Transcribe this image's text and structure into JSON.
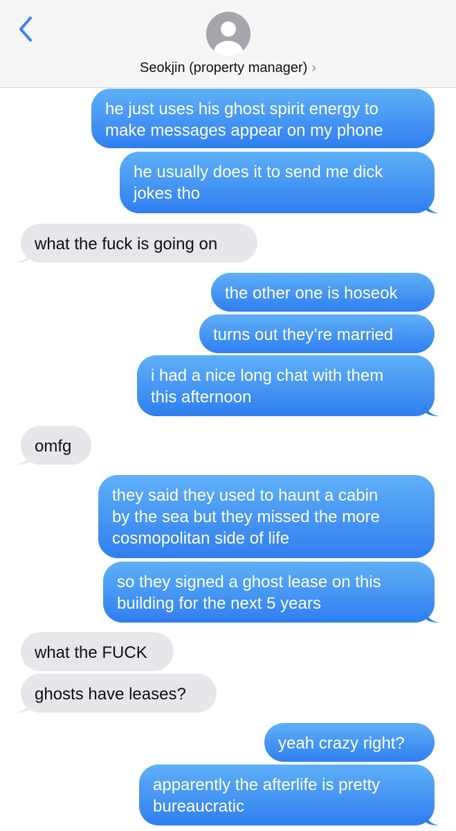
{
  "header": {
    "contact_name": "Seokjin (property manager)",
    "back_icon": "chevron-left-icon",
    "avatar_icon": "person-avatar-icon"
  },
  "colors": {
    "outgoing_top": "#5fb0f7",
    "outgoing_bottom": "#2f7ef0",
    "incoming": "#e6e6eb",
    "back_arrow": "#3a82f7"
  },
  "messages": [
    {
      "dir": "out",
      "lines": [
        "he just uses his ghost spirit energy to",
        "make messages appear on my phone"
      ]
    },
    {
      "dir": "out",
      "lines": [
        "he usually does it to send me dick",
        "jokes tho"
      ]
    },
    {
      "dir": "in",
      "lines": [
        "what the fuck is going on"
      ]
    },
    {
      "dir": "out",
      "lines": [
        "the other one is hoseok"
      ]
    },
    {
      "dir": "out",
      "lines": [
        "turns out they’re married"
      ]
    },
    {
      "dir": "out",
      "lines": [
        "i had a nice long chat with them",
        "this afternoon"
      ]
    },
    {
      "dir": "in",
      "lines": [
        "omfg"
      ]
    },
    {
      "dir": "out",
      "lines": [
        "they said they used to haunt a cabin",
        "by the sea but they missed the more",
        "cosmopolitan side of life"
      ]
    },
    {
      "dir": "out",
      "lines": [
        "so they signed a ghost lease on this",
        "building for the next 5 years"
      ]
    },
    {
      "dir": "in",
      "lines": [
        "what the FUCK"
      ]
    },
    {
      "dir": "in",
      "lines": [
        "ghosts have leases?"
      ]
    },
    {
      "dir": "out",
      "lines": [
        "yeah crazy right?"
      ]
    },
    {
      "dir": "out",
      "lines": [
        "apparently the afterlife is pretty",
        "bureaucratic"
      ]
    }
  ]
}
